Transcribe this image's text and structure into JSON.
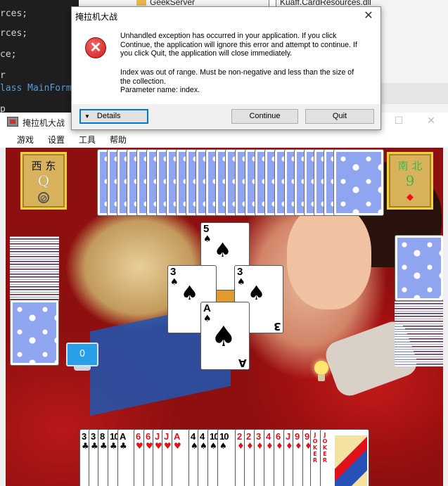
{
  "editor": {
    "code_lines": [
      {
        "text": "rces;",
        "color": "#d4d4d4"
      },
      {
        "text": "rces;",
        "color": "#d4d4d4"
      },
      {
        "text": "ce;",
        "color": "#d4d4d4"
      },
      {
        "text": "r",
        "color": "#d4d4d4"
      },
      {
        "text": "lass MainForm",
        "color": "#569cd6"
      },
      {
        "text": "p",
        "color": "#d4d4d4"
      }
    ]
  },
  "explorer": {
    "folder_label": "GeekServer",
    "dll_label": "Kuaff.CardResources.dll"
  },
  "game_window": {
    "title": "掩拉机大战",
    "minimize_glyph": "—",
    "maximize_glyph": "☐",
    "close_glyph": "✕",
    "menu": [
      "游戏",
      "设置",
      "工具",
      "帮助"
    ],
    "players": {
      "west": {
        "name": "西 东",
        "role": "Q",
        "status": "pass",
        "status_glyph": "⊘"
      },
      "east": {
        "name": "南 北",
        "role": "9",
        "status": "diamond",
        "status_glyph": "◆"
      }
    },
    "monitor_count": "0",
    "played_cards": [
      {
        "rank": "5",
        "suit": "♠",
        "color": "black"
      },
      {
        "rank": "3",
        "suit": "♠",
        "color": "black"
      },
      {
        "rank": "3",
        "suit": "♠",
        "color": "black"
      },
      {
        "rank": "A",
        "suit": "♠",
        "color": "black"
      }
    ],
    "hand": [
      {
        "rank": "3",
        "suit": "♣",
        "color": "black"
      },
      {
        "rank": "3",
        "suit": "♣",
        "color": "black"
      },
      {
        "rank": "8",
        "suit": "♣",
        "color": "black"
      },
      {
        "rank": "10",
        "suit": "♣",
        "color": "black"
      },
      {
        "rank": "A",
        "suit": "♣",
        "color": "black"
      },
      {
        "rank": "6",
        "suit": "♥",
        "color": "red"
      },
      {
        "rank": "6",
        "suit": "♥",
        "color": "red"
      },
      {
        "rank": "J",
        "suit": "♥",
        "color": "red"
      },
      {
        "rank": "J",
        "suit": "♥",
        "color": "red"
      },
      {
        "rank": "A",
        "suit": "♥",
        "color": "red"
      },
      {
        "rank": "4",
        "suit": "♠",
        "color": "black"
      },
      {
        "rank": "4",
        "suit": "♠",
        "color": "black"
      },
      {
        "rank": "10",
        "suit": "♠",
        "color": "black"
      },
      {
        "rank": "10",
        "suit": "♠",
        "color": "black"
      },
      {
        "rank": "2",
        "suit": "♦",
        "color": "red"
      },
      {
        "rank": "2",
        "suit": "♦",
        "color": "red"
      },
      {
        "rank": "3",
        "suit": "♦",
        "color": "red"
      },
      {
        "rank": "4",
        "suit": "♦",
        "color": "red"
      },
      {
        "rank": "6",
        "suit": "♦",
        "color": "red"
      },
      {
        "rank": "J",
        "suit": "♦",
        "color": "red"
      },
      {
        "rank": "9",
        "suit": "♦",
        "color": "red"
      },
      {
        "rank": "9",
        "suit": "♦",
        "color": "red"
      },
      {
        "rank": "JOKER",
        "suit": "",
        "color": "red"
      },
      {
        "rank": "JOKER",
        "suit": "",
        "color": "red"
      }
    ]
  },
  "dialog": {
    "title": "掩拉机大战",
    "close_glyph": "✕",
    "icon_glyph": "✕",
    "message_lines": [
      "Unhandled exception has occurred in your application. If you click",
      "Continue, the application will ignore this error and attempt to continue. If",
      "you click Quit, the application will close immediately."
    ],
    "detail_lines": [
      "Index was out of range. Must be non-negative and less than the size of",
      "the collection.",
      "Parameter name: index."
    ],
    "details_label": "Details",
    "details_caret": "▼",
    "continue_label": "Continue",
    "quit_label": "Quit"
  },
  "colors": {
    "error_red": "#d21919",
    "table_red": "#c21919",
    "card_back_blue": "#8fa5f0",
    "focus_blue": "#0078d7"
  }
}
